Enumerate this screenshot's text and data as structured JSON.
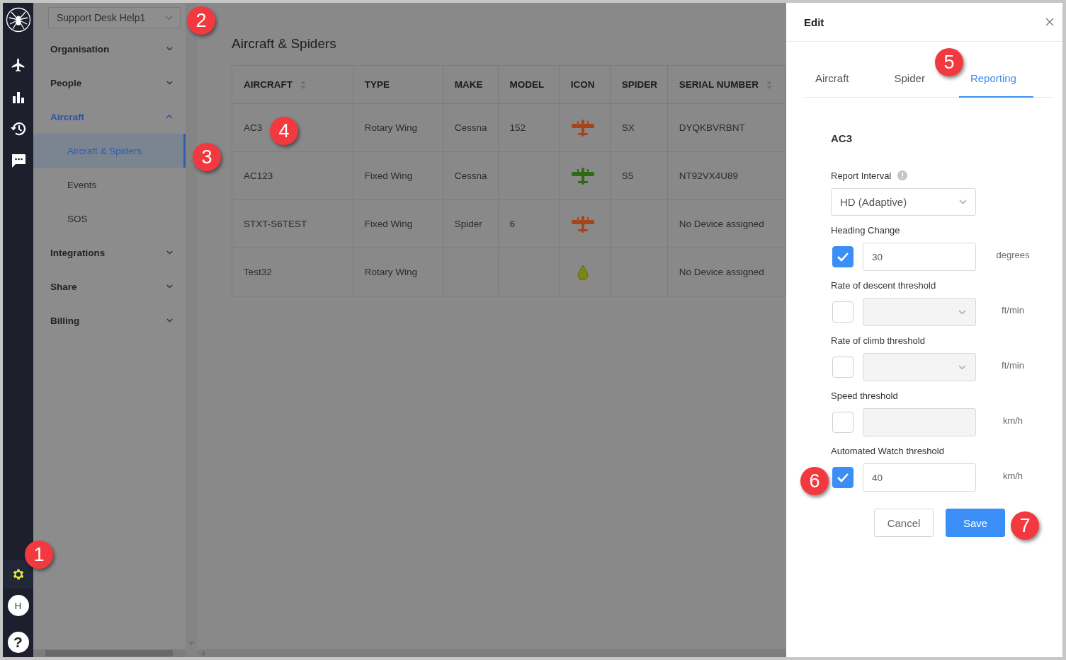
{
  "rail": {
    "items": [
      {
        "selected": false
      },
      {
        "selected": false
      },
      {
        "selected": false
      },
      {
        "selected": false
      }
    ],
    "settings": {
      "selected": true
    },
    "avatar": "H",
    "help": "?"
  },
  "account": {
    "value": "Support Desk Help1"
  },
  "nav": [
    {
      "label": "Organisation",
      "expanded": false,
      "selected": false
    },
    {
      "label": "People",
      "expanded": false,
      "selected": false
    },
    {
      "label": "Aircraft",
      "expanded": true,
      "selected": true,
      "children": [
        {
          "label": "Aircraft & Spiders",
          "selected": true
        },
        {
          "label": "Events",
          "selected": false
        },
        {
          "label": "SOS",
          "selected": false
        }
      ]
    },
    {
      "label": "Integrations",
      "expanded": false,
      "selected": false
    },
    {
      "label": "Share",
      "expanded": false,
      "selected": false
    },
    {
      "label": "Billing",
      "expanded": false,
      "selected": false
    }
  ],
  "page": {
    "title": "Aircraft & Spiders"
  },
  "table": {
    "columns": [
      {
        "label": "AIRCRAFT",
        "sortable": true
      },
      {
        "label": "TYPE",
        "sortable": false
      },
      {
        "label": "MAKE",
        "sortable": false
      },
      {
        "label": "MODEL",
        "sortable": false
      },
      {
        "label": "ICON",
        "sortable": false
      },
      {
        "label": "SPIDER",
        "sortable": false
      },
      {
        "label": "SERIAL NUMBER",
        "sortable": true
      }
    ],
    "rows": [
      {
        "aircraft": "AC3",
        "type": "Rotary Wing",
        "make": "Cessna",
        "model": "152",
        "icon": {
          "kind": "plane",
          "color": "#a8441a"
        },
        "spider": "SX",
        "serial": "DYQKBVRBNT"
      },
      {
        "aircraft": "AC123",
        "type": "Fixed Wing",
        "make": "Cessna",
        "icon": {
          "kind": "plane",
          "color": "#2e6b12"
        },
        "spider": "S5",
        "serial": "NT92VX4U89"
      },
      {
        "aircraft": "STXT-S6TEST",
        "type": "Fixed Wing",
        "make": "Spider",
        "model": "6",
        "icon": {
          "kind": "plane",
          "color": "#a8441a"
        },
        "serial": "No Device assigned"
      },
      {
        "aircraft": "Test32",
        "type": "Rotary Wing",
        "icon": {
          "kind": "drop",
          "color": "#7a8710"
        },
        "serial": "No Device assigned"
      }
    ]
  },
  "drawer": {
    "title": "Edit",
    "tabs": [
      {
        "label": "Aircraft",
        "selected": false
      },
      {
        "label": "Spider",
        "selected": false
      },
      {
        "label": "Reporting",
        "selected": true
      }
    ],
    "heading": "AC3",
    "report_interval": {
      "label": "Report Interval",
      "value": "HD (Adaptive)"
    },
    "thresholds": [
      {
        "label": "Heading Change",
        "kind": "input",
        "checked": true,
        "value": "30",
        "unit": "degrees"
      },
      {
        "label": "Rate of descent threshold",
        "kind": "select",
        "checked": false,
        "unit": "ft/min"
      },
      {
        "label": "Rate of climb threshold",
        "kind": "select",
        "checked": false,
        "unit": "ft/min"
      },
      {
        "label": "Speed threshold",
        "kind": "input",
        "checked": false,
        "unit": "km/h"
      },
      {
        "label": "Automated Watch threshold",
        "kind": "input",
        "checked": true,
        "value": "40",
        "unit": "km/h"
      }
    ],
    "buttons": [
      {
        "label": "Cancel",
        "kind": "secondary"
      },
      {
        "label": "Save",
        "kind": "primary"
      }
    ]
  },
  "callouts": [
    "1",
    "2",
    "3",
    "4",
    "5",
    "6",
    "7"
  ]
}
